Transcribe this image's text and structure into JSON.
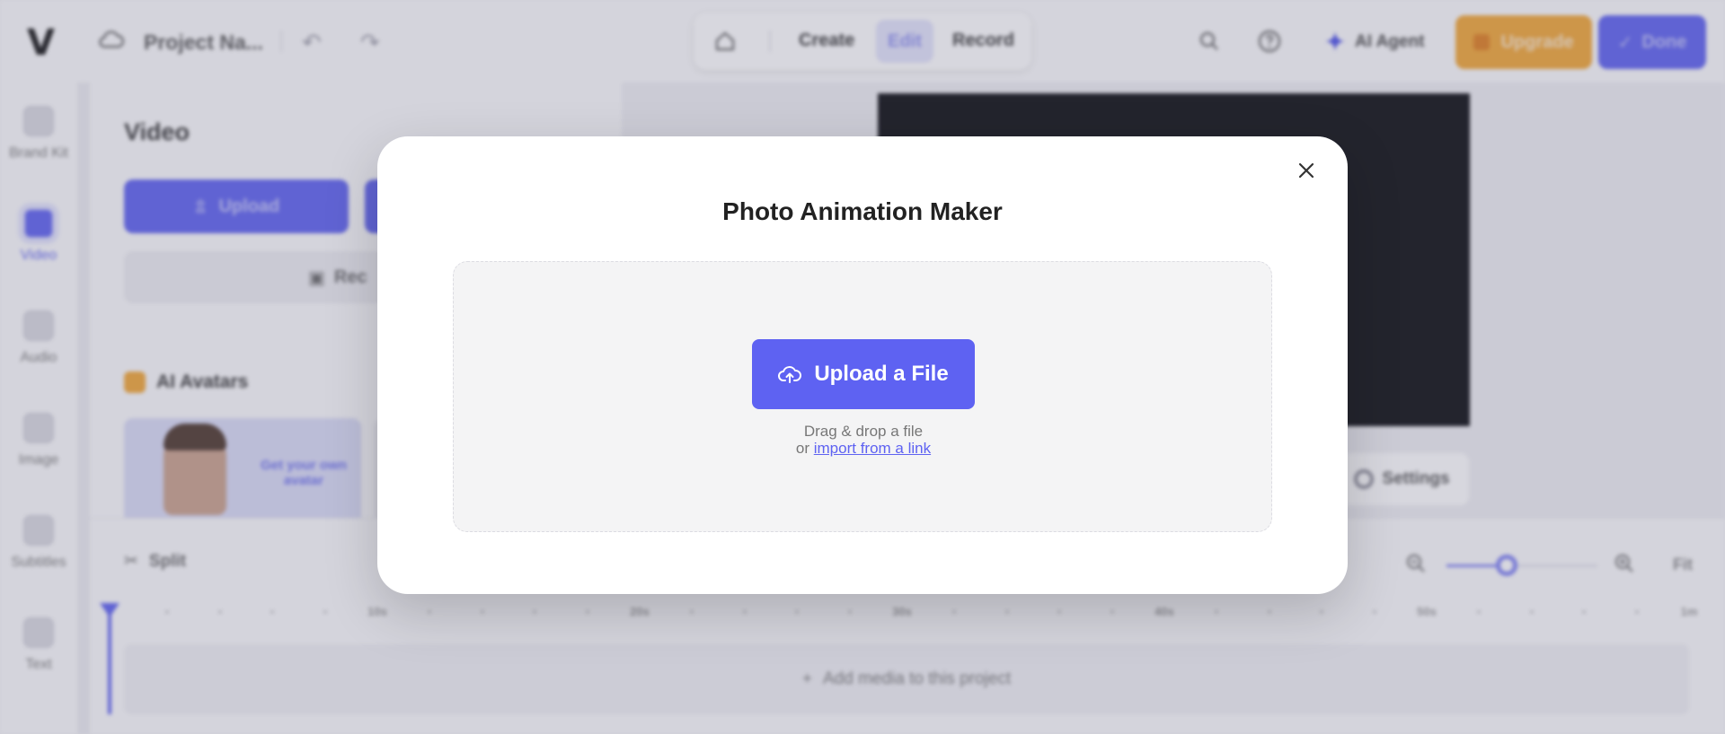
{
  "topbar": {
    "logo": "V",
    "project_name": "Project Na...",
    "modes": {
      "create": "Create",
      "edit": "Edit",
      "record": "Record"
    },
    "ai_agent_label": "AI Agent",
    "upgrade_label": "Upgrade",
    "done_label": "Done",
    "icons": [
      "cloud-icon",
      "undo-icon",
      "redo-icon",
      "home-icon",
      "search-icon",
      "help-icon",
      "sparkle-icon"
    ]
  },
  "rail": {
    "items": [
      {
        "label": "Brand Kit",
        "icon": "brand-kit-icon"
      },
      {
        "label": "Video",
        "icon": "video-icon",
        "active": true
      },
      {
        "label": "Audio",
        "icon": "audio-icon"
      },
      {
        "label": "Image",
        "icon": "image-icon"
      },
      {
        "label": "Subtitles",
        "icon": "subtitles-icon"
      },
      {
        "label": "Text",
        "icon": "text-icon"
      }
    ]
  },
  "panel": {
    "title": "Video",
    "upload_label": "Upload",
    "record_label": "Rec",
    "avatars_title": "AI Avatars",
    "avatar_cta": "Get your own avatar"
  },
  "preview": {
    "settings_label": "Settings"
  },
  "timeline": {
    "split_label": "Split",
    "fit_label": "Fit",
    "zoom_level": 0.4,
    "ruler_labels": [
      "10s",
      "20s",
      "30s",
      "40s",
      "50s",
      "1m"
    ],
    "empty_track_label": "Add media to this project"
  },
  "modal": {
    "title": "Photo Animation Maker",
    "upload_button": "Upload a File",
    "drag_hint": "Drag & drop a file",
    "or_text": "or",
    "import_link": "import from a link"
  },
  "colors": {
    "accent": "#5e62f2",
    "upgrade": "#f2a531",
    "video_canvas": "#06070b",
    "overlay": "rgba(110,112,135,0.28)"
  }
}
